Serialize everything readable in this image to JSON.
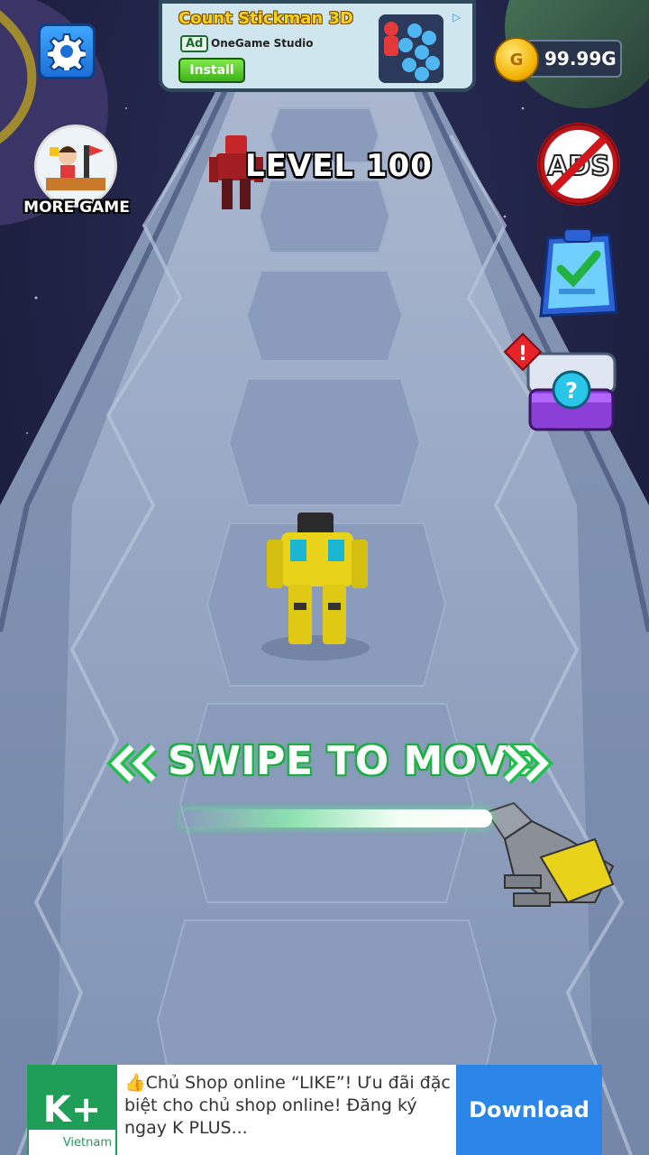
{
  "top_ad": {
    "title": "Count Stickman 3D",
    "badge": "Ad",
    "studio": "OneGame Studio",
    "install_label": "Install",
    "info_icon": "play-triangle-icon"
  },
  "hud": {
    "settings_icon": "gear-icon",
    "coins": "99.99G",
    "coin_icon": "coin-icon",
    "level": "LEVEL 100",
    "more_game_label": "MORE GAME"
  },
  "side_buttons": {
    "no_ads_text": "ADS",
    "no_ads_icon": "no-ads-icon",
    "tasks_icon": "clipboard-check-icon",
    "mystery_icon": "mystery-box-icon",
    "alert_mark": "!",
    "mystery_mark": "?"
  },
  "tutorial": {
    "swipe_label": "SWIPE TO MOVE",
    "left_arrows": "left-double-chevron-icon",
    "right_arrows": "right-double-chevron-icon",
    "hand_icon": "robot-hand-icon"
  },
  "bottom_ad": {
    "logo": "K+",
    "logo_sub": "Vietnam",
    "text": "👍Chủ Shop online “LIKE”! Ưu đãi đặc biệt cho chủ shop online! Đăng ký ngay K PLUS...",
    "download_label": "Download"
  },
  "colors": {
    "swipe_green": "#1ec24a",
    "sky": "#1a1d3a",
    "track": "#8fa0bd",
    "robot_yellow": "#e8d21a",
    "enemy_red": "#c4262a",
    "download_blue": "#2c86e8"
  }
}
